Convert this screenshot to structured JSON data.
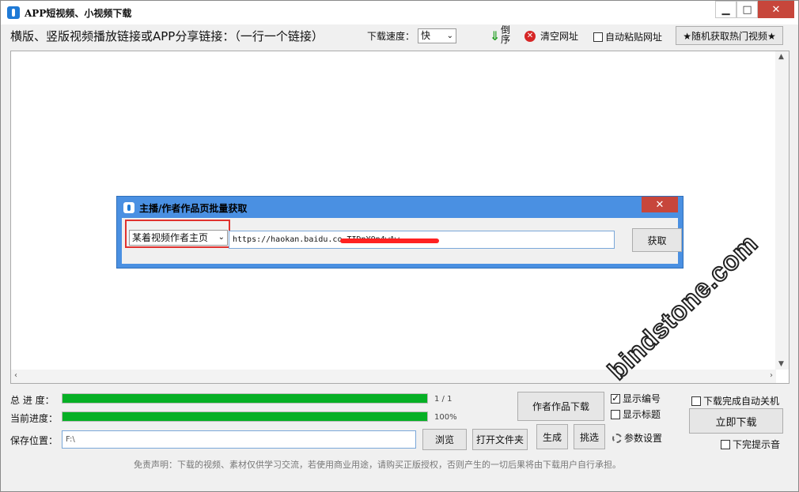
{
  "window": {
    "title": "APP短视频、小视频下载"
  },
  "toolbar": {
    "url_prompt": "横版、竖版视频播放链接或APP分享链接：（一行一个链接）",
    "speed_label": "下载速度：",
    "speed_value": "快",
    "sort_label": "倒序",
    "clear_label": "清空网址",
    "auto_paste_label": "自动粘贴网址",
    "hot_button": "★随机获取热门视频★"
  },
  "dialog": {
    "title": "主播/作者作品页批量获取",
    "select_value": "某着视频作者主页",
    "url_value": "https://haokan.baidu.co                    TIDnYOp4wAw",
    "fetch_button": "获取"
  },
  "progress": {
    "total_label": "总 进 度：",
    "total_text": "1 / 1",
    "total_fraction": 1.0,
    "current_label": "当前进度：",
    "current_text": "100%",
    "current_fraction": 1.0
  },
  "save": {
    "label": "保存位置：",
    "path": "F:\\",
    "browse_button": "浏览",
    "open_folder_button": "打开文件夹"
  },
  "actions": {
    "author_download": "作者作品下载",
    "generate": "生成",
    "pick": "挑选",
    "show_number": "显示编号",
    "show_title": "显示标题",
    "settings": "参数设置",
    "auto_shutdown": "下载完成自动关机",
    "download_now": "立即下载",
    "done_sound": "下完提示音"
  },
  "disclaimer": "免责声明：下载的视频、素材仅供学习交流，若使用商业用途，请购买正版授权，否则产生的一切后果将由下载用户自行承担。",
  "watermark": "bindstone.com",
  "colors": {
    "progress_fill": "#06b025",
    "dialog_border": "#4a90e2",
    "highlight": "#e0322f"
  }
}
